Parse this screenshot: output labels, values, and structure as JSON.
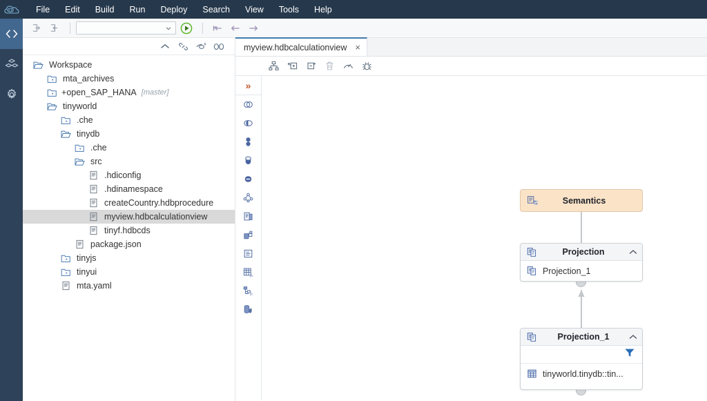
{
  "app": {
    "logo_icon": "sap-cloud-logo"
  },
  "menubar": {
    "items": [
      {
        "label": "File",
        "name": "menu-file"
      },
      {
        "label": "Edit",
        "name": "menu-edit"
      },
      {
        "label": "Build",
        "name": "menu-build"
      },
      {
        "label": "Run",
        "name": "menu-run"
      },
      {
        "label": "Deploy",
        "name": "menu-deploy"
      },
      {
        "label": "Search",
        "name": "menu-search"
      },
      {
        "label": "View",
        "name": "menu-view"
      },
      {
        "label": "Tools",
        "name": "menu-tools"
      },
      {
        "label": "Help",
        "name": "menu-help"
      }
    ]
  },
  "activitybar": {
    "items": [
      {
        "icon": "code-brackets-icon",
        "name": "activity-develop",
        "selected": true
      },
      {
        "icon": "cubes-icon",
        "name": "activity-database-explorer",
        "selected": false
      },
      {
        "icon": "gear-icon",
        "name": "activity-settings",
        "selected": false
      }
    ]
  },
  "toolbar": {
    "import_icon": "import-icon",
    "export_icon": "export-icon",
    "run_config_value": "",
    "run_config_placeholder": "",
    "run_icon": "run-play-icon",
    "debug_step_icon": "step-icon",
    "back_icon": "arrow-left-icon",
    "forward_icon": "arrow-right-icon"
  },
  "explorer": {
    "header_icons": [
      {
        "icon": "collapse-up-icon",
        "name": "collapse-all-icon"
      },
      {
        "icon": "link-icon",
        "name": "link-editor-icon"
      },
      {
        "icon": "eye-slash-icon",
        "name": "hide-hidden-files-icon"
      },
      {
        "icon": "binoculars-icon",
        "name": "find-icon"
      }
    ],
    "tree": [
      {
        "label": "Workspace",
        "icon": "folder-open-icon",
        "indent": 0,
        "selected": false,
        "branch": "",
        "prefix": ""
      },
      {
        "label": "mta_archives",
        "icon": "folder-plus-icon",
        "indent": 1,
        "selected": false,
        "branch": "",
        "prefix": ""
      },
      {
        "label": "open_SAP_HANA",
        "icon": "folder-plus-icon",
        "indent": 1,
        "selected": false,
        "branch": "[master]",
        "prefix": "+"
      },
      {
        "label": "tinyworld",
        "icon": "folder-open-icon",
        "indent": 1,
        "selected": false,
        "branch": "",
        "prefix": ""
      },
      {
        "label": ".che",
        "icon": "folder-plus-icon",
        "indent": 2,
        "selected": false,
        "branch": "",
        "prefix": ""
      },
      {
        "label": "tinydb",
        "icon": "folder-open-icon",
        "indent": 2,
        "selected": false,
        "branch": "",
        "prefix": ""
      },
      {
        "label": ".che",
        "icon": "folder-plus-icon",
        "indent": 3,
        "selected": false,
        "branch": "",
        "prefix": ""
      },
      {
        "label": "src",
        "icon": "folder-open-icon",
        "indent": 3,
        "selected": false,
        "branch": "",
        "prefix": ""
      },
      {
        "label": ".hdiconfig",
        "icon": "file-icon",
        "indent": 4,
        "selected": false,
        "branch": "",
        "prefix": ""
      },
      {
        "label": ".hdinamespace",
        "icon": "file-icon",
        "indent": 4,
        "selected": false,
        "branch": "",
        "prefix": ""
      },
      {
        "label": "createCountry.hdbprocedure",
        "icon": "file-icon",
        "indent": 4,
        "selected": false,
        "branch": "",
        "prefix": ""
      },
      {
        "label": "myview.hdbcalculationview",
        "icon": "file-icon",
        "indent": 4,
        "selected": true,
        "branch": "",
        "prefix": ""
      },
      {
        "label": "tinyf.hdbcds",
        "icon": "file-icon",
        "indent": 4,
        "selected": false,
        "branch": "",
        "prefix": ""
      },
      {
        "label": "package.json",
        "icon": "file-icon",
        "indent": 3,
        "selected": false,
        "branch": "",
        "prefix": ""
      },
      {
        "label": "tinyjs",
        "icon": "folder-plus-icon",
        "indent": 2,
        "selected": false,
        "branch": "",
        "prefix": ""
      },
      {
        "label": "tinyui",
        "icon": "folder-plus-icon",
        "indent": 2,
        "selected": false,
        "branch": "",
        "prefix": ""
      },
      {
        "label": "mta.yaml",
        "icon": "file-icon",
        "indent": 2,
        "selected": false,
        "branch": "",
        "prefix": ""
      }
    ]
  },
  "editor": {
    "tabs": [
      {
        "label": "myview.hdbcalculationview",
        "close_label": "×",
        "active": true
      }
    ],
    "toolbar_buttons": [
      {
        "icon": "auto-layout-icon",
        "name": "auto-layout-button",
        "dim": false
      },
      {
        "icon": "expand-node-icon",
        "name": "expand-all-button",
        "dim": false
      },
      {
        "icon": "collapse-node-icon",
        "name": "collapse-all-button",
        "dim": false
      },
      {
        "icon": "trash-icon",
        "name": "delete-button",
        "dim": true
      },
      {
        "icon": "gauge-icon",
        "name": "performance-analysis-button",
        "dim": false
      },
      {
        "icon": "bug-icon",
        "name": "debug-button",
        "dim": false
      }
    ],
    "rail": {
      "expand_label": "»",
      "expand_name": "expand-palette-icon",
      "icons": [
        {
          "icon": "join-icon",
          "name": "palette-join-icon"
        },
        {
          "icon": "union-icon",
          "name": "palette-union-icon"
        },
        {
          "icon": "projection-icon",
          "name": "palette-projection-icon"
        },
        {
          "icon": "aggregation-icon",
          "name": "palette-aggregation-icon"
        },
        {
          "icon": "rank-icon",
          "name": "palette-rank-icon"
        },
        {
          "icon": "star-join-icon",
          "name": "palette-star-join-icon"
        },
        {
          "icon": "data-source-icon",
          "name": "palette-data-source-icon"
        },
        {
          "icon": "cube-icon",
          "name": "palette-cube-icon"
        },
        {
          "icon": "table-function-icon",
          "name": "palette-table-function-icon"
        },
        {
          "icon": "table-fx-icon",
          "name": "palette-calculated-column-icon"
        },
        {
          "icon": "hierarchy-fx-icon",
          "name": "palette-hierarchy-icon"
        },
        {
          "icon": "secure-data-icon",
          "name": "palette-privileges-icon"
        }
      ]
    }
  },
  "diagram": {
    "semantics": {
      "title": "Semantics",
      "icon": "semantics-icon"
    },
    "projection": {
      "title": "Projection",
      "icon": "projection-icon",
      "chevron": "chevron-up-icon",
      "rows": [
        {
          "label": "Projection_1",
          "icon": "projection-icon"
        }
      ]
    },
    "projection_1": {
      "title": "Projection_1",
      "icon": "projection-icon",
      "chevron": "chevron-up-icon",
      "filter_icon": "filter-icon",
      "rows": [
        {
          "label": "tinyworld.tinydb::tin...",
          "icon": "table-icon"
        }
      ]
    }
  },
  "colors": {
    "menubar_bg": "#26384c",
    "activitybar_bg": "#2e4259",
    "activity_selected": "#43688f",
    "semantics_bg": "#fbe3c8",
    "tree_selected": "#d9d9d9",
    "tab_accent": "#427cac",
    "filter_blue": "#2b6cb8",
    "connector": "#c3c7cb"
  }
}
